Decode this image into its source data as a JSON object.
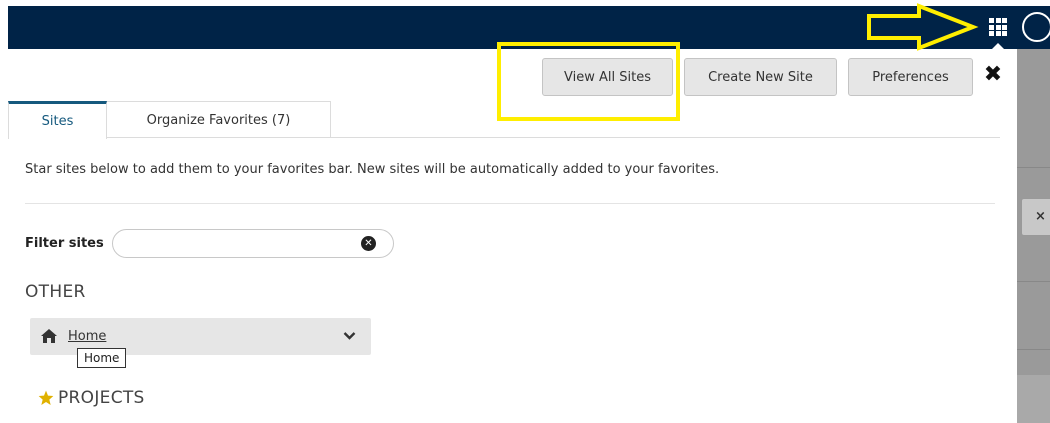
{
  "header": {
    "apps_icon": "grid-icon",
    "profile_icon": "circle-icon",
    "annotation_color": "#ffee00",
    "bar_color": "#002347"
  },
  "actions": {
    "view_all": "View All Sites",
    "create_new": "Create New Site",
    "preferences": "Preferences",
    "close_glyph": "✖"
  },
  "tabs": [
    {
      "label": "Sites",
      "active": true
    },
    {
      "label": "Organize Favorites (7)",
      "active": false
    }
  ],
  "instructions": "Star sites below to add them to your favorites bar. New sites will be automatically added to your favorites.",
  "filter": {
    "label": "Filter sites",
    "value": "",
    "clear_icon": "times-circle-icon"
  },
  "sections": {
    "other": "OTHER",
    "projects": "PROJECTS"
  },
  "home": {
    "label": "Home",
    "tooltip": "Home",
    "icon": "home-icon"
  },
  "peek_button": "×"
}
